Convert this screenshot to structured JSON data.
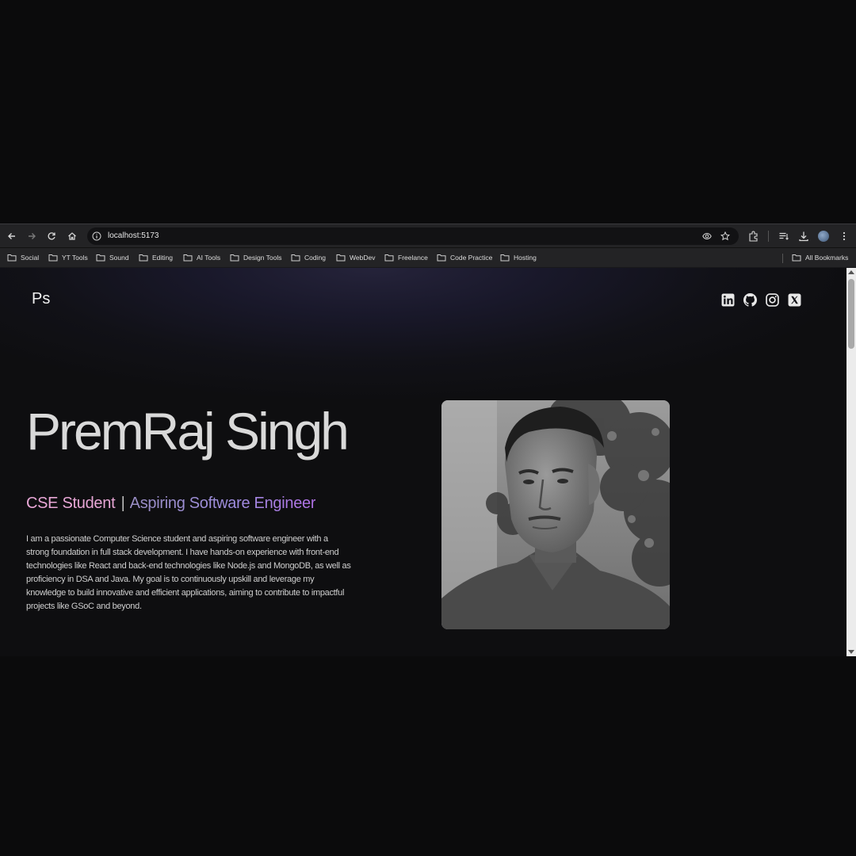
{
  "browser": {
    "url": "localhost:5173",
    "bookmarks": [
      "Social",
      "YT Tools",
      "Sound",
      "Editing",
      "AI Tools",
      "Design Tools",
      "Coding",
      "WebDev",
      "Freelance",
      "Code Practice",
      "Hosting"
    ],
    "all_bookmarks": "All Bookmarks"
  },
  "page": {
    "logo": "Ps",
    "socials": [
      "linkedin-icon",
      "github-icon",
      "instagram-icon",
      "x-icon"
    ],
    "name": "PremRaj Singh",
    "tagline_role": "CSE Student",
    "tagline_separator": "|",
    "tagline_goal": "Aspiring Software Engineer",
    "bio": "I am a passionate Computer Science student and aspiring software engineer with a strong foundation in full stack development. I have hands-on experience with front-end technologies like React and back-end technologies like Node.js and MongoDB, as well as proficiency in DSA and Java. My goal is to continuously upskill and leverage my knowledge to build innovative and efficient applications, aiming to contribute to impactful projects like GSoC and beyond."
  },
  "colors": {
    "tagline_role": "#e7a6d5",
    "tagline_goal": "#a98ee0",
    "background": "#0e0e10"
  }
}
